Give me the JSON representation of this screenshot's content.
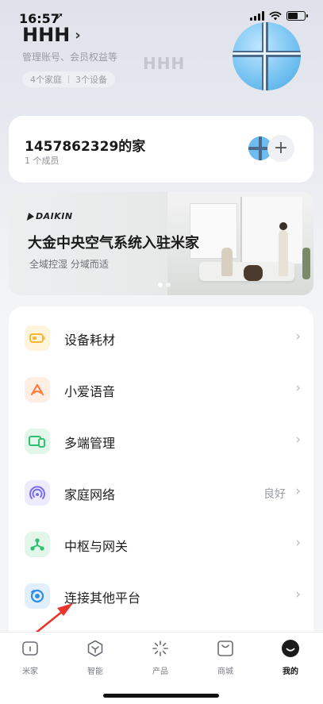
{
  "status_bar": {
    "time": "16:57",
    "location_glyph": "➚"
  },
  "profile": {
    "name": "HHH",
    "subtitle": "管理账号、会员权益等",
    "home_count": "4个家庭",
    "device_count": "3个设备",
    "ghost_name": "HHH"
  },
  "home_card": {
    "title": "1457862329的家",
    "members": "1 个成员",
    "add_label": "+"
  },
  "banner": {
    "brand": "DAIKIN",
    "title": "大金中央空气系统入驻米家",
    "subtitle": "全域控湿   分域而适"
  },
  "menu": [
    {
      "label": "设备耗材",
      "value": "",
      "icon": "battery-icon",
      "color": "#f7b733",
      "bg": "#fff4dc"
    },
    {
      "label": "小爱语音",
      "value": "",
      "icon": "xiaoai-icon",
      "color": "#ff7a3d",
      "bg": "#ffeee3"
    },
    {
      "label": "多端管理",
      "value": "",
      "icon": "multi-device-icon",
      "color": "#2fbf71",
      "bg": "#e2f6ea"
    },
    {
      "label": "家庭网络",
      "value": "良好",
      "icon": "network-icon",
      "color": "#7b6cf6",
      "bg": "#ecebff"
    },
    {
      "label": "中枢与网关",
      "value": "",
      "icon": "hub-icon",
      "color": "#2fbf71",
      "bg": "#e2f6ea"
    },
    {
      "label": "连接其他平台",
      "value": "",
      "icon": "connect-platform-icon",
      "color": "#2f8fe8",
      "bg": "#e1eefc"
    }
  ],
  "tabs": [
    {
      "label": "米家",
      "icon": "home-icon"
    },
    {
      "label": "智能",
      "icon": "smart-icon"
    },
    {
      "label": "产品",
      "icon": "product-icon"
    },
    {
      "label": "商城",
      "icon": "mall-icon"
    },
    {
      "label": "我的",
      "icon": "profile-icon",
      "active": true
    }
  ],
  "chevron": "›",
  "annotation_color": "#e8352b"
}
